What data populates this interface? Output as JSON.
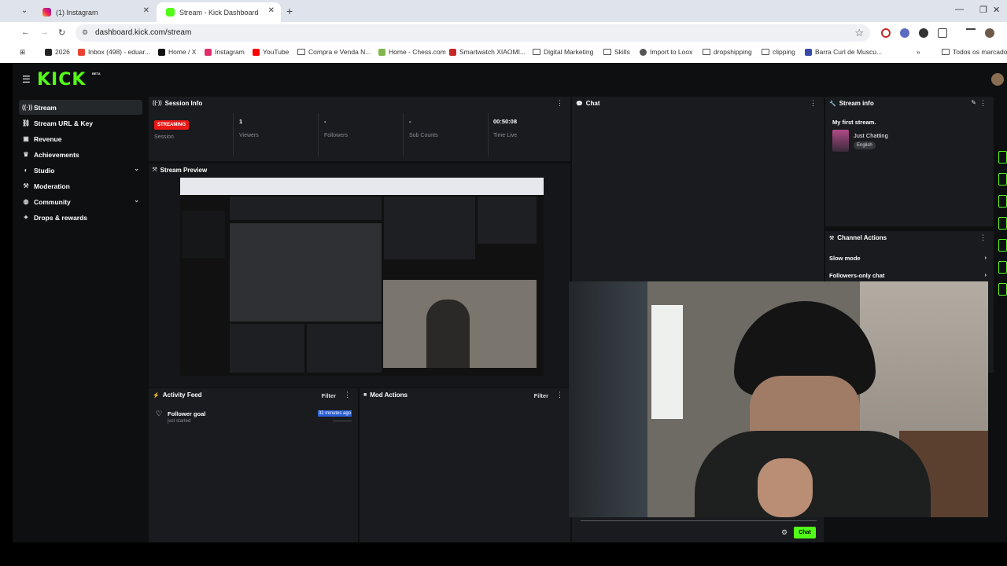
{
  "browser": {
    "tabs": [
      {
        "title": "(1) Instagram",
        "active": false
      },
      {
        "title": "Stream - Kick Dashboard",
        "active": true
      }
    ],
    "url": "dashboard.kick.com/stream",
    "bookmarks": [
      "2026",
      "Inbox (498) - eduar...",
      "Home / X",
      "Instagram",
      "YouTube",
      "Compra e Venda N...",
      "Home - Chess.com",
      "Smartwatch XIAOMI...",
      "Digital Marketing",
      "Skills",
      "Import to Loox",
      "dropshipping",
      "clipping",
      "Barra Curl de Muscu...",
      "Todos os marcadores"
    ]
  },
  "app": {
    "logo": "KICK",
    "logo_badge": "BETA"
  },
  "sidebar": {
    "items": [
      {
        "label": "Stream",
        "active": true
      },
      {
        "label": "Stream URL & Key"
      },
      {
        "label": "Revenue"
      },
      {
        "label": "Achievements"
      },
      {
        "label": "Studio",
        "expandable": true
      },
      {
        "label": "Moderation"
      },
      {
        "label": "Community",
        "expandable": true
      },
      {
        "label": "Drops & rewards"
      }
    ]
  },
  "session_info": {
    "title": "Session Info",
    "status_badge": "STREAMING",
    "stats": [
      {
        "label": "Session",
        "value": ""
      },
      {
        "label": "Viewers",
        "value": "1"
      },
      {
        "label": "Followers",
        "value": "-"
      },
      {
        "label": "Sub Counts",
        "value": "-"
      },
      {
        "label": "Time Live",
        "value": "00:50:08"
      }
    ]
  },
  "stream_preview": {
    "title": "Stream Preview"
  },
  "chat": {
    "title": "Chat",
    "send_label": "Chat"
  },
  "stream_info": {
    "title": "Stream info",
    "stream_title": "My first stream.",
    "category": "Just Chatting",
    "language": "English"
  },
  "channel_actions": {
    "title": "Channel Actions",
    "items": [
      "Slow mode",
      "Followers-only chat"
    ]
  },
  "activity_feed": {
    "title": "Activity Feed",
    "filter_label": "Filter",
    "items": [
      {
        "title": "Follower goal",
        "subtitle": "just started",
        "time": "32 minutes ago"
      }
    ]
  },
  "mod_actions": {
    "title": "Mod Actions",
    "filter_label": "Filter"
  },
  "colors": {
    "brand": "#53fc18",
    "live": "#e91916",
    "panel": "#191b1f",
    "background": "#0d0f10"
  }
}
